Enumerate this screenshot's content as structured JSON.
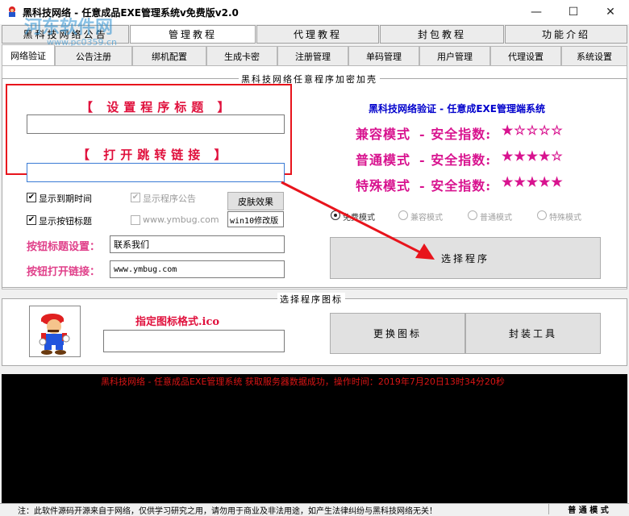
{
  "window": {
    "title": "黑科技网络 - 任意成品EXE管理系统v免费版v2.0",
    "minimize": "—",
    "maximize": "☐",
    "close": "✕"
  },
  "watermark": {
    "brand": "河东软件网",
    "url": "www.pc0359.cn"
  },
  "top_tabs": [
    "黑科技网络公告",
    "管理教程",
    "代理教程",
    "封包教程",
    "功能介绍"
  ],
  "sub_tabs": [
    "网络验证",
    "公告注册",
    "绑机配置",
    "生成卡密",
    "注册管理",
    "单码管理",
    "用户管理",
    "代理设置",
    "系统设置"
  ],
  "encrypt_group": {
    "label": "黑科技网络任意程序加密加壳",
    "set_title_label": "【 设置程序标题 】",
    "title_value": "",
    "open_link_label": "【 打开跳转链接 】",
    "link_value": "",
    "checkboxes": {
      "show_expiry": "显示到期时间",
      "show_notice": "显示程序公告",
      "show_button_title": "显示按钮标题",
      "ymbug": "www.ymbug.com"
    },
    "skin_button": "皮肤效果",
    "skin_value": "win10修改版",
    "button_title_label": "按钮标题设置：",
    "button_title_value": "联系我们",
    "button_link_label": "按钮打开链接：",
    "button_link_value": "www.ymbug.com",
    "brand_line": "黑科技网络验证 - 任意成EXE管理端系统",
    "modes": [
      {
        "name": "兼容模式",
        "label": "- 安全指数:",
        "stars": "★☆☆☆☆"
      },
      {
        "name": "普通模式",
        "label": "- 安全指数:",
        "stars": "★★★★☆"
      },
      {
        "name": "特殊模式",
        "label": "- 安全指数:",
        "stars": "★★★★★"
      }
    ],
    "radio_options": [
      "免费模式",
      "兼容模式",
      "普通模式",
      "特殊模式"
    ],
    "select_program_button": "选择程序"
  },
  "icon_group": {
    "label": "选择程序图标",
    "format_hint": "指定图标格式.ico",
    "icon_path": "",
    "change_icon_button": "更换图标",
    "pack_tool_button": "封装工具"
  },
  "console": {
    "message": "黑科技网络 - 任意成品EXE管理系统 获取服务器数据成功，操作时间：2019年7月20日13时34分20秒"
  },
  "status": {
    "notice": "注：此软件源码开源来自于网络，仅供学习研究之用，请勿用于商业及非法用途，如产生法律纠纷与黑科技网络无关！",
    "mode": "普 通 模 式"
  },
  "colors": {
    "accent_red": "#e0103c",
    "mode_magenta": "#d8138f",
    "console_text": "#d81515",
    "brand_blue": "#0000cc"
  }
}
